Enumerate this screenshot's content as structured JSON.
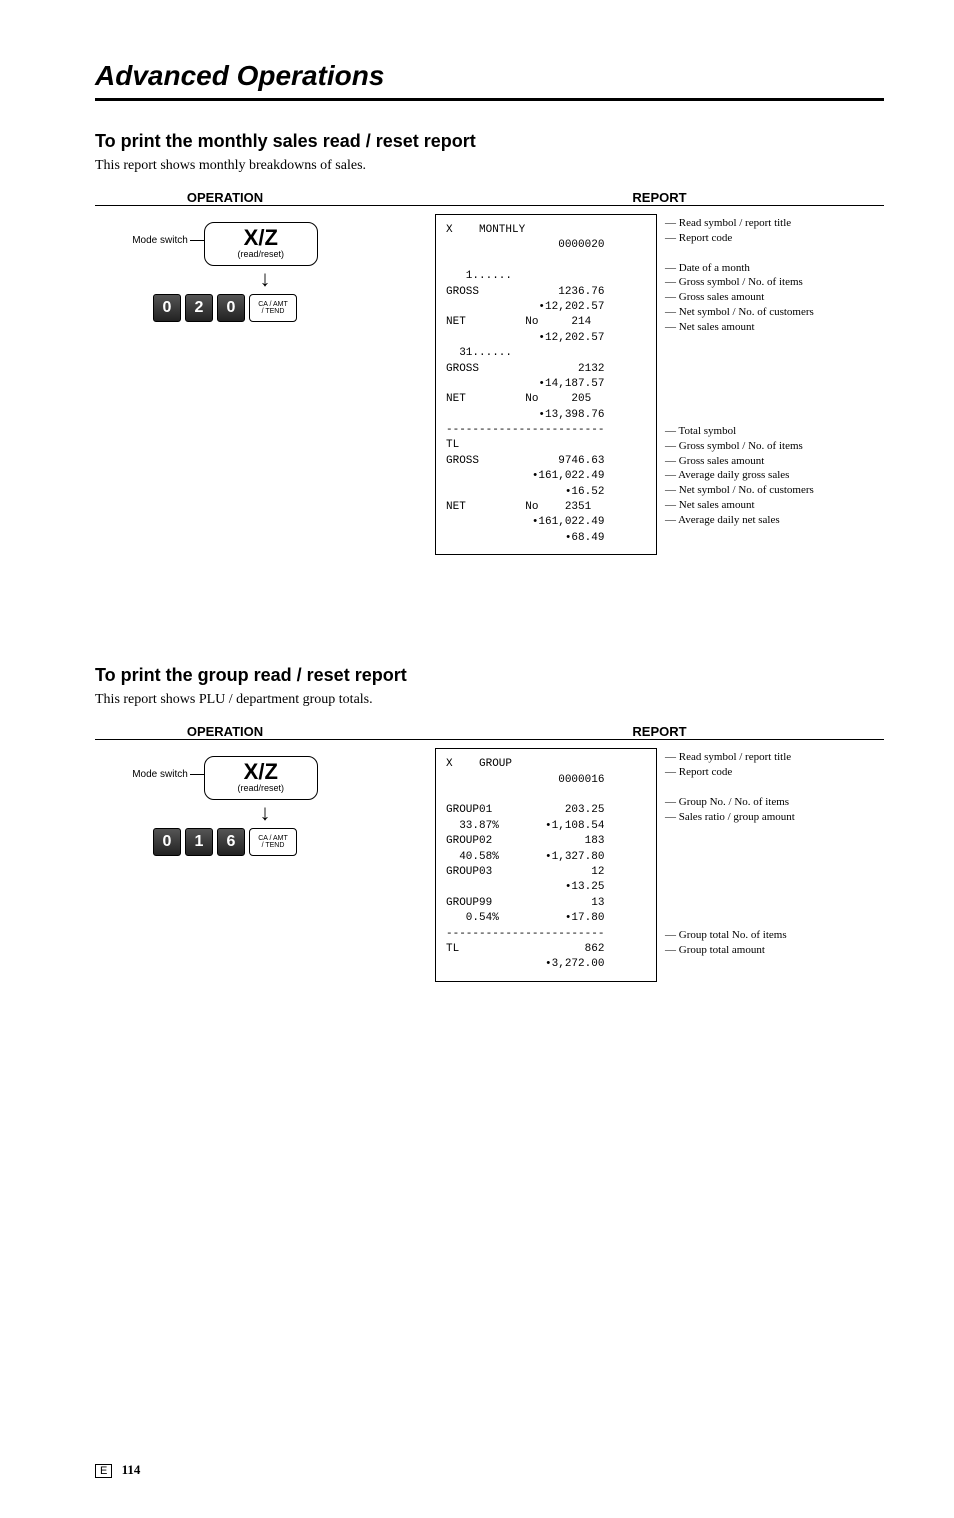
{
  "chapter_title": "Advanced Operations",
  "footer": {
    "e": "E",
    "page": "114"
  },
  "headings": {
    "operation": "OPERATION",
    "report": "REPORT"
  },
  "switch": {
    "xz": "X/Z",
    "readreset": "(read/reset)",
    "mode_switch": "Mode switch",
    "ca_amt_top": "CA / AMT",
    "ca_amt_bot": "/ TEND"
  },
  "sections": [
    {
      "title": "To print the monthly sales read / reset report",
      "desc": "This report shows monthly breakdowns of sales.",
      "keys": [
        "0",
        "2",
        "0"
      ],
      "receipt_lines": [
        "X    MONTHLY",
        "                 0000020",
        "",
        "   1......",
        "GROSS            1236.76",
        "              •12,202.57",
        "NET         No     214",
        "              •12,202.57",
        "  31......",
        "GROSS               2132",
        "              •14,187.57",
        "NET         No     205",
        "              •13,398.76",
        "------------------------",
        "TL",
        "GROSS            9746.63",
        "             •161,022.49",
        "                  •16.52",
        "NET         No    2351",
        "             •161,022.49",
        "                  •68.49"
      ],
      "torn_after": 7,
      "annotations": [
        "— Read symbol / report title",
        "— Report code",
        "",
        "— Date of a month",
        "— Gross symbol / No. of items",
        "— Gross sales amount",
        "— Net symbol / No. of customers",
        "— Net sales amount",
        "",
        "",
        "",
        "",
        "",
        "",
        "— Total symbol",
        "— Gross symbol / No. of items",
        "— Gross sales amount",
        "— Average daily gross sales",
        "— Net symbol / No. of customers",
        "— Net sales amount",
        "— Average daily net sales"
      ]
    },
    {
      "title": "To print the group read / reset report",
      "desc": "This report shows PLU / department group totals.",
      "keys": [
        "0",
        "1",
        "6"
      ],
      "receipt_lines": [
        "X    GROUP",
        "                 0000016",
        "",
        "GROUP01           203.25",
        "  33.87%       •1,108.54",
        "GROUP02              183",
        "  40.58%       •1,327.80",
        "GROUP03               12",
        "                  •13.25",
        "GROUP99               13",
        "   0.54%          •17.80",
        "------------------------",
        "TL                   862",
        "               •3,272.00"
      ],
      "torn_after": 8,
      "annotations": [
        "— Read symbol / report title",
        "— Report code",
        "",
        "— Group No. / No. of items",
        "— Sales ratio / group amount",
        "",
        "",
        "",
        "",
        "",
        "",
        "",
        "— Group total No. of items",
        "— Group total amount"
      ]
    }
  ]
}
